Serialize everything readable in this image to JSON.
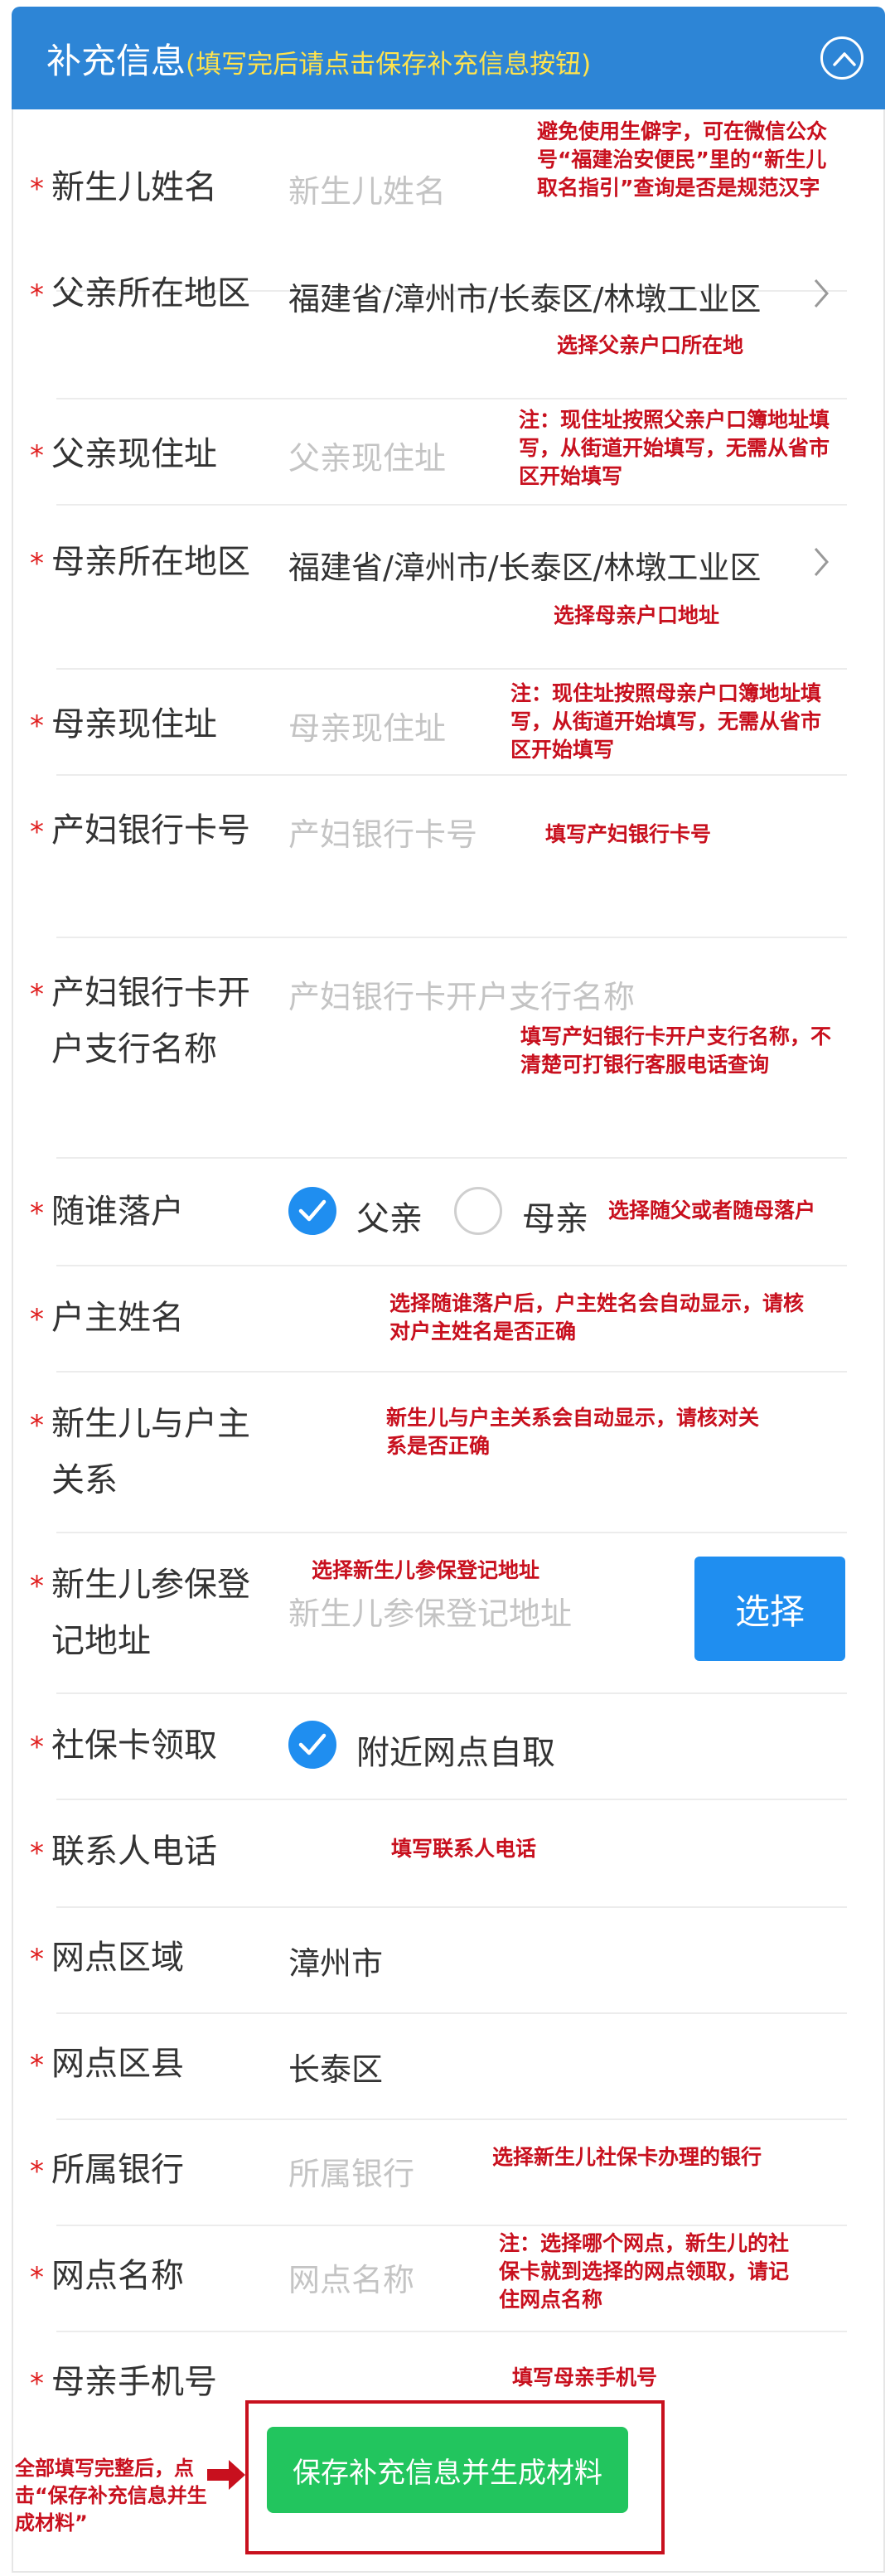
{
  "header": {
    "title": "补充信息",
    "subtitle": "(填写完后请点击保存补充信息按钮)"
  },
  "fields": {
    "baby_name": {
      "label": "新生儿姓名",
      "placeholder": "新生儿姓名"
    },
    "father_region": {
      "label": "父亲所在地区",
      "value": "福建省/漳州市/长泰区/林墩工业区"
    },
    "father_address": {
      "label": "父亲现住址",
      "placeholder": "父亲现住址"
    },
    "mother_region": {
      "label": "母亲所在地区",
      "value": "福建省/漳州市/长泰区/林墩工业区"
    },
    "mother_address": {
      "label": "母亲现住址",
      "placeholder": "母亲现住址"
    },
    "bank_card": {
      "label": "产妇银行卡号",
      "placeholder": "产妇银行卡号"
    },
    "bank_branch": {
      "label": "产妇银行卡开户支行名称",
      "placeholder": "产妇银行卡开户支行名称"
    },
    "household_follow": {
      "label": "随谁落户",
      "option_father": "父亲",
      "option_mother": "母亲",
      "selected": "父亲"
    },
    "householder_name": {
      "label": "户主姓名"
    },
    "relation": {
      "label": "新生儿与户主关系"
    },
    "insurance_address": {
      "label": "新生儿参保登记地址",
      "placeholder": "新生儿参保登记地址",
      "button": "选择"
    },
    "card_pickup": {
      "label": "社保卡领取",
      "option": "附近网点自取"
    },
    "contact_phone": {
      "label": "联系人电话"
    },
    "outlet_area": {
      "label": "网点区域",
      "value": "漳州市"
    },
    "outlet_county": {
      "label": "网点区县",
      "value": "长泰区"
    },
    "bank": {
      "label": "所属银行",
      "placeholder": "所属银行"
    },
    "outlet_name": {
      "label": "网点名称",
      "placeholder": "网点名称"
    },
    "mother_phone": {
      "label": "母亲手机号"
    }
  },
  "notes": {
    "baby_name": "避免使用生僻字，可在微信公众号“福建治安便民”里的“新生儿取名指引”查询是否是规范汉字",
    "father_region": "选择父亲户口所在地",
    "father_address": "注：现住址按照父亲户口簿地址填写，从街道开始填写，无需从省市区开始填写",
    "mother_region": "选择母亲户口地址",
    "mother_address": "注：现住址按照母亲户口簿地址填写，从街道开始填写，无需从省市区开始填写",
    "bank_card": "填写产妇银行卡号",
    "bank_branch": "填写产妇银行卡开户支行名称，不清楚可打银行客服电话查询",
    "household_follow": "选择随父或者随母落户",
    "householder_name": "选择随谁落户后，户主姓名会自动显示，请核对户主姓名是否正确",
    "relation": "新生儿与户主关系会自动显示，请核对关系是否正确",
    "insurance_address": "选择新生儿参保登记地址",
    "contact_phone": "填写联系人电话",
    "bank": "选择新生儿社保卡办理的银行",
    "outlet_name": "注：选择哪个网点，新生儿的社保卡就到选择的网点领取，请记住网点名称",
    "mother_phone": "填写母亲手机号",
    "save": "全部填写完整后，点击“保存补充信息并生成材料”"
  },
  "save_button": "保存补充信息并生成材料",
  "colors": {
    "header_bg": "#2d85d6",
    "header_subtitle": "#ffe34d",
    "required_star": "#e02020",
    "note_red": "#c8101e",
    "check_blue": "#1f8ef0",
    "save_green": "#22c55e"
  },
  "icons": {
    "collapse": "chevron-up-circle-icon",
    "region_arrow": "chevron-right-icon",
    "check": "check-circle-icon",
    "pointer": "arrow-right-icon"
  }
}
